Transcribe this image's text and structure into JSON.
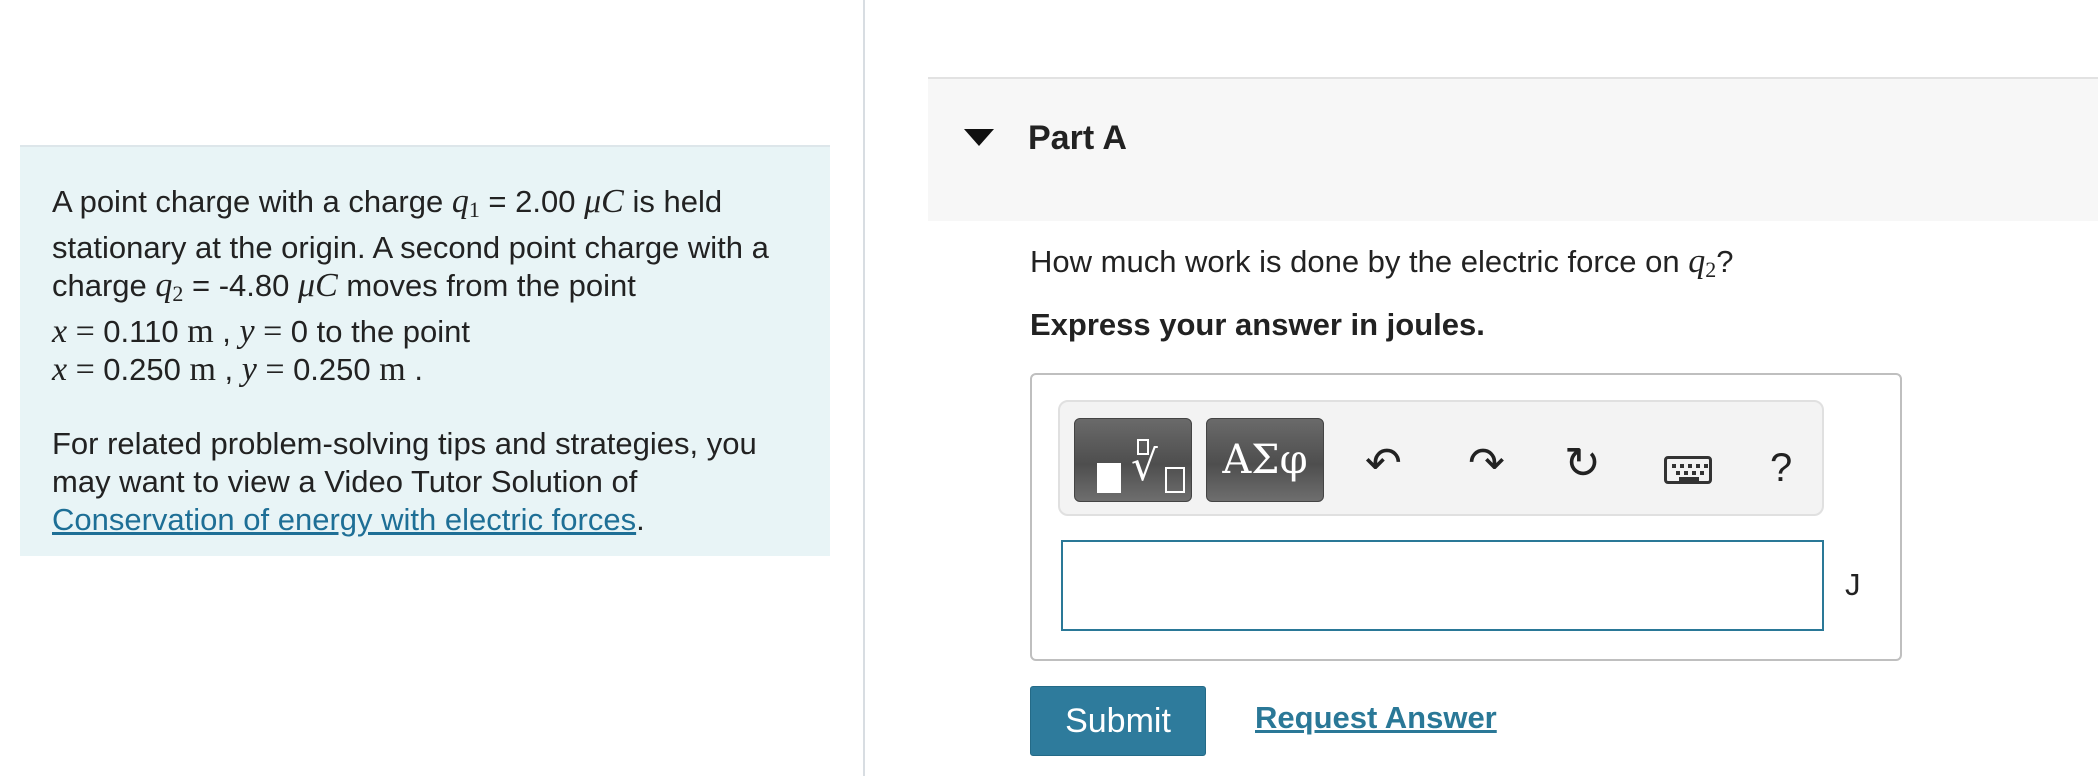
{
  "problem": {
    "line1_a": "A point charge with a charge ",
    "q1_sym": "q",
    "q1_sub": "1",
    "line1_b": " = 2.00 ",
    "mu_unit": "μC",
    "line1_c": " is held",
    "line2": "stationary at the origin. A second point charge with a",
    "line3_a": "charge ",
    "q2_sym": "q",
    "q2_sub": "2",
    "line3_b": " = -4.80 ",
    "line3_c": " moves from the point",
    "x_sym": "x",
    "y_sym": "y",
    "eq": " = ",
    "pt1_x": "0.110",
    "m_unit": "m",
    "comma": " , ",
    "pt1_y": "0",
    "to_the_point": " to the point",
    "pt2_x": "0.250",
    "pt2_y": "0.250",
    "period": " .",
    "tips_text": "For related problem-solving tips and strategies, you may want to view a Video Tutor Solution of ",
    "tips_link": "Conservation of energy with electric forces",
    "tips_end": "."
  },
  "part": {
    "title": "Part A",
    "question_a": "How much work is done by the electric force on ",
    "question_sym": "q",
    "question_sub": "2",
    "question_b": "?",
    "instruction": "Express your answer in joules."
  },
  "toolbar": {
    "greek_label": "ΑΣφ",
    "undo_glyph": "↶",
    "redo_glyph": "↷",
    "reset_glyph": "↻",
    "help_label": "?"
  },
  "answer": {
    "value": "",
    "placeholder": "",
    "unit": "J"
  },
  "actions": {
    "submit_label": "Submit",
    "request_label": "Request Answer"
  }
}
